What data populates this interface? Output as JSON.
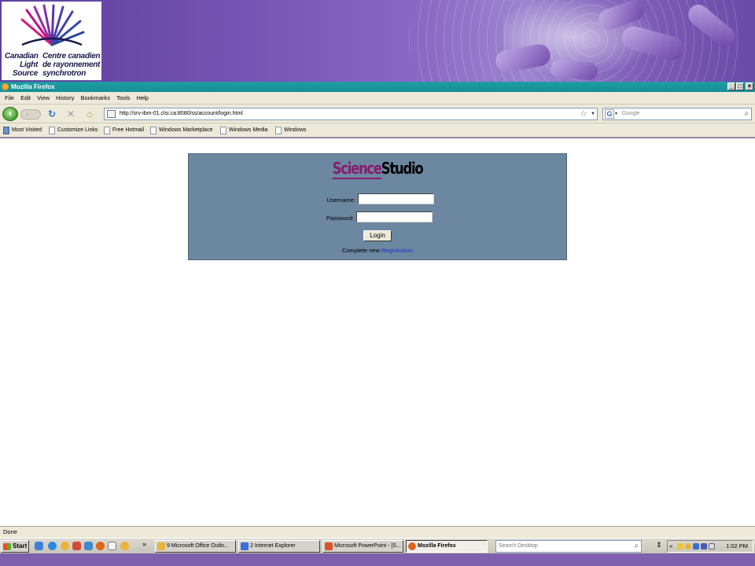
{
  "logo": {
    "line1_left": "Canadian",
    "line2_left": "Light",
    "line3_left": "Source",
    "line1_right": "Centre canadien",
    "line2_right": "de rayonnement",
    "line3_right": "synchrotron"
  },
  "window": {
    "title": "Mozilla Firefox",
    "minimize_label": "_",
    "maximize_label": "□",
    "close_label": "×"
  },
  "menu": [
    "File",
    "Edit",
    "View",
    "History",
    "Bookmarks",
    "Tools",
    "Help"
  ],
  "nav": {
    "url": "http://srv-ibm-01.clsi.ca:8080/ss/account/login.html",
    "search_placeholder": "Google"
  },
  "bookmarks": [
    "Most Visited",
    "Customize Links",
    "Free Hotmail",
    "Windows Marketplace",
    "Windows Media",
    "Windows"
  ],
  "login": {
    "brand_part1": "Science",
    "brand_part2": "Studio",
    "username_label": "Username:",
    "password_label": "Password:",
    "login_button": "Login",
    "complete_text": "Complete new",
    "registration_link": "Registration"
  },
  "status": {
    "text": "Done"
  },
  "taskbar": {
    "start_label": "Start",
    "overflow_label": "»",
    "tasks": [
      {
        "label": "9 Microsoft Office Outlo...",
        "color": "#e9b33a"
      },
      {
        "label": "2 Internet Explorer",
        "color": "#3a6fd8"
      },
      {
        "label": "Microsoft PowerPoint - [S...",
        "color": "#d9542b"
      },
      {
        "label": "Mozilla Firefox",
        "color": "#e0641a"
      }
    ],
    "desk_search_placeholder": "Search Desktop",
    "clock": "1:02 PM",
    "tray_expand": "«"
  }
}
